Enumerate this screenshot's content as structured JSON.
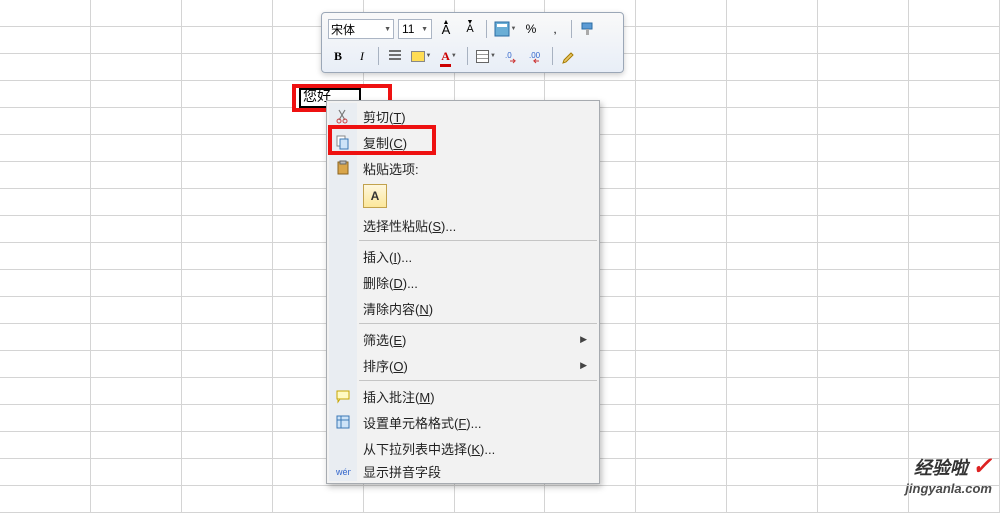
{
  "toolbar": {
    "font_name": "宋体",
    "font_size": "11",
    "percent": "%",
    "comma": ",",
    "bold": "B",
    "italic": "I",
    "grow": "A",
    "shrink": "A",
    "font_a": "A"
  },
  "cell": {
    "value": "您好"
  },
  "menu": {
    "cut": "剪切(",
    "cut_k": "T",
    "cut_end": ")",
    "copy": "复制(",
    "copy_k": "C",
    "copy_end": ")",
    "paste_options": "粘贴选项:",
    "paste_a": "A",
    "paste_special": "选择性粘贴(",
    "paste_special_k": "S",
    "paste_special_end": ")...",
    "insert": "插入(",
    "insert_k": "I",
    "insert_end": ")...",
    "delete": "删除(",
    "delete_k": "D",
    "delete_end": ")...",
    "clear": "清除内容(",
    "clear_k": "N",
    "clear_end": ")",
    "filter": "筛选(",
    "filter_k": "E",
    "filter_end": ")",
    "sort": "排序(",
    "sort_k": "O",
    "sort_end": ")",
    "comment": "插入批注(",
    "comment_k": "M",
    "comment_end": ")",
    "format": "设置单元格格式(",
    "format_k": "F",
    "format_end": ")...",
    "dropdown": "从下拉列表中选择(",
    "dropdown_k": "K",
    "dropdown_end": ")...",
    "pinyin": "显示拼音字段"
  },
  "watermark": {
    "top": "经验啦",
    "url": "jingyanla.com"
  }
}
